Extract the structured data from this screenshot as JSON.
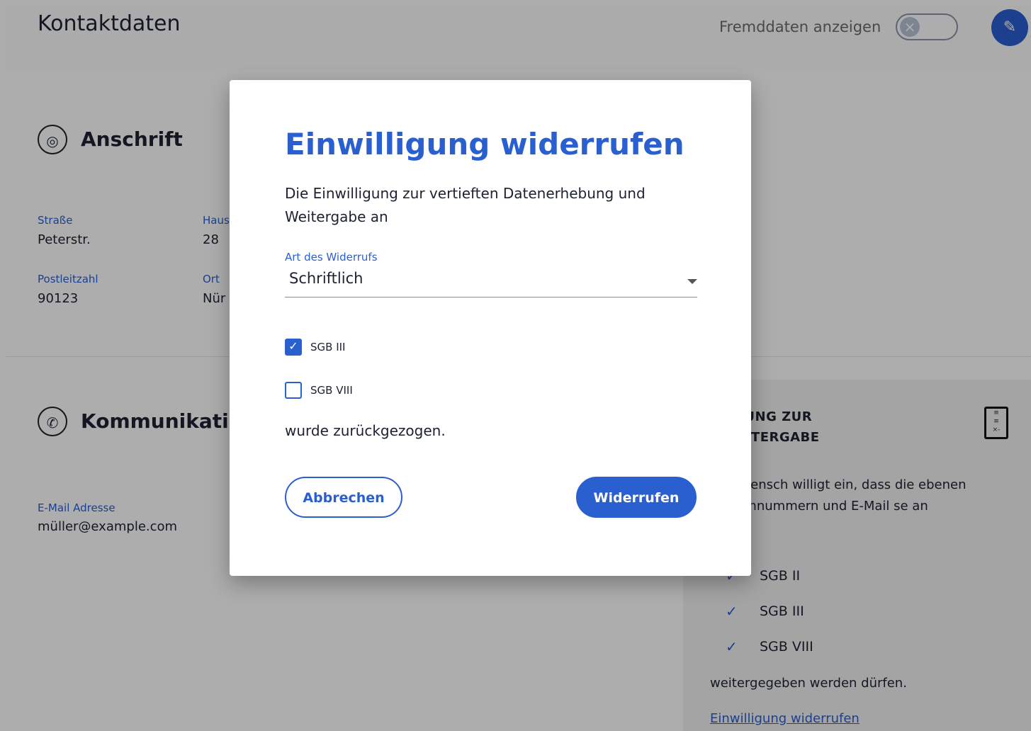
{
  "header": {
    "title": "Kontaktdaten",
    "toggle_label": "Fremddaten anzeigen",
    "toggle_icon": "×",
    "edit_icon": "✎"
  },
  "anschrift": {
    "title": "Anschrift",
    "icon": "◎",
    "fields": [
      {
        "label": "Straße",
        "value": "Peterstr."
      },
      {
        "label": "Haus",
        "value": "28"
      },
      {
        "label": "Postleitzahl",
        "value": "90123"
      },
      {
        "label": "Ort",
        "value": "Nür"
      }
    ]
  },
  "kommunikation": {
    "title": "Kommunikation",
    "icon": "✆",
    "email_label": "E-Mail Adresse",
    "email_value": "müller@example.com"
  },
  "consent_panel": {
    "title_line1": "LLIGUNG ZUR",
    "title_line2": "NWEITERGABE",
    "text": "nge Mensch willigt ein, dass die ebenen Telefonnummern und E-Mail se an",
    "items": [
      "SGB II",
      "SGB III",
      "SGB VIII"
    ],
    "footer": "weitergegeben werden dürfen.",
    "link": "Einwilligung widerrufen",
    "check_glyph": "✓"
  },
  "dialog": {
    "title": "Einwilligung widerrufen",
    "description": "Die Einwilligung zur vertieften Datenerhebung und Weitergabe an",
    "select_label": "Art des Widerrufs",
    "select_value": "Schriftlich",
    "checkboxes": [
      {
        "label": "SGB III",
        "checked": true,
        "glyph": "✓"
      },
      {
        "label": "SGB VIII",
        "checked": false,
        "glyph": ""
      }
    ],
    "footer_text": "wurde zurückgezogen.",
    "cancel_label": "Abbrechen",
    "confirm_label": "Widerrufen"
  },
  "colors": {
    "accent": "#2a5fd0",
    "overlay": "rgba(0,0,0,0.32)"
  }
}
